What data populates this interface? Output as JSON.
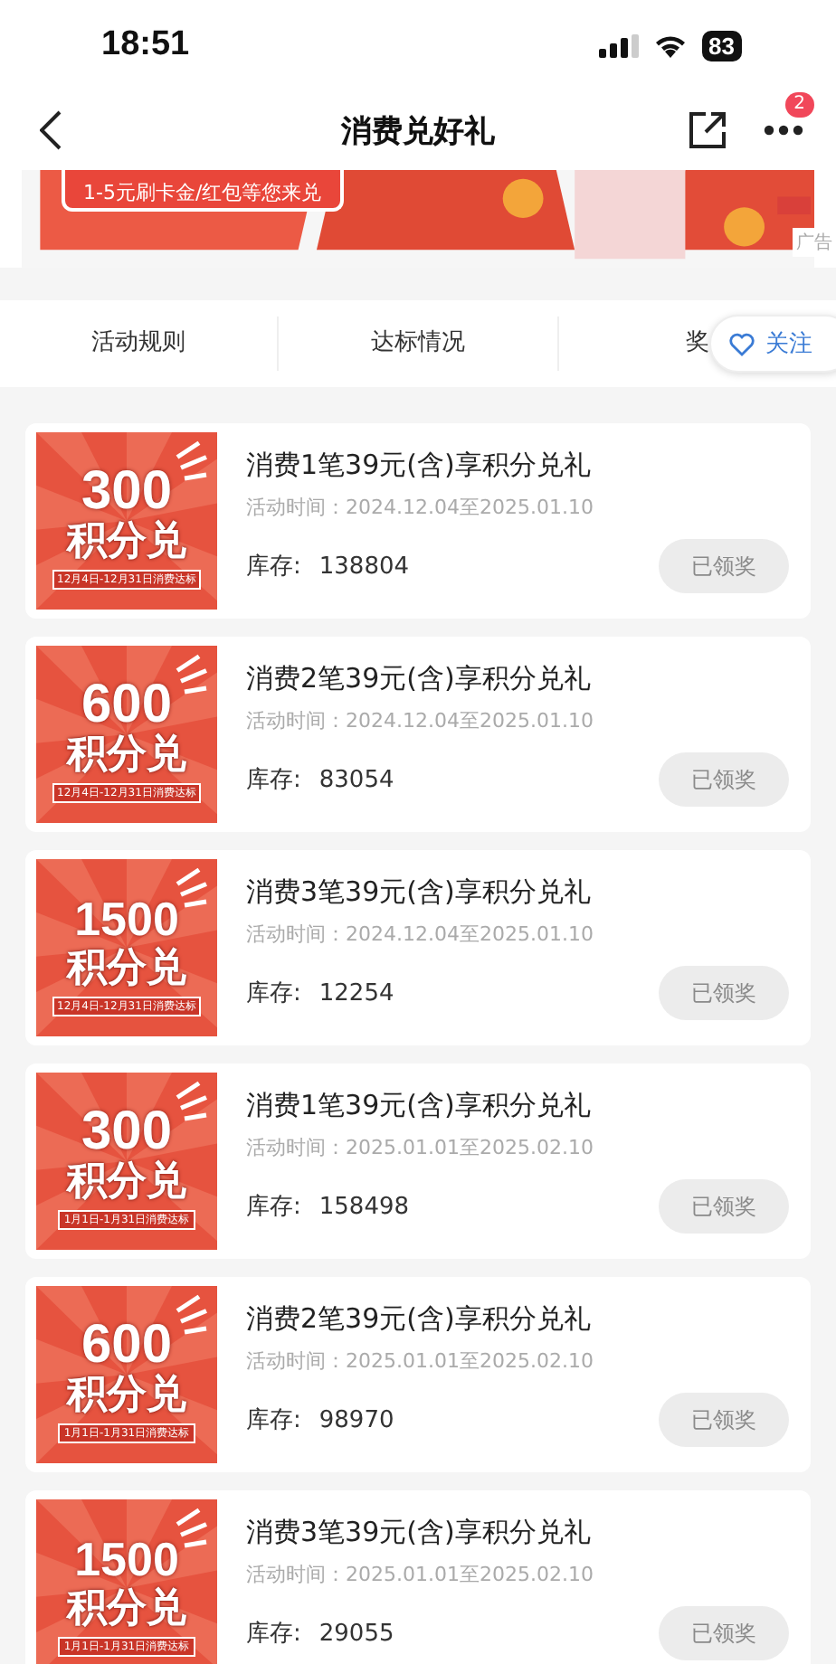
{
  "status_bar": {
    "time": "18:51",
    "battery": "83"
  },
  "nav": {
    "title": "消费兑好礼",
    "badge": "2"
  },
  "banner": {
    "slogan": "1-5元刷卡金/红包等您来兑",
    "ad_label": "广告"
  },
  "tabs": [
    {
      "label": "活动规则"
    },
    {
      "label": "达标情况"
    },
    {
      "label": "奖"
    }
  ],
  "follow_button": {
    "label": "关注"
  },
  "offers": [
    {
      "amount": "300",
      "badge_text": "积分兑",
      "period": "12月4日-12月31日消费达标",
      "title": "消费1笔39元(含)享积分兑礼",
      "time": "活动时间：2024.12.04至2025.01.10",
      "stock_label": "库存:",
      "stock": "138804",
      "button": {
        "label": "已领奖",
        "disabled": true
      }
    },
    {
      "amount": "600",
      "badge_text": "积分兑",
      "period": "12月4日-12月31日消费达标",
      "title": "消费2笔39元(含)享积分兑礼",
      "time": "活动时间：2024.12.04至2025.01.10",
      "stock_label": "库存:",
      "stock": "83054",
      "button": {
        "label": "已领奖",
        "disabled": true
      }
    },
    {
      "amount": "1500",
      "badge_text": "积分兑",
      "period": "12月4日-12月31日消费达标",
      "title": "消费3笔39元(含)享积分兑礼",
      "time": "活动时间：2024.12.04至2025.01.10",
      "stock_label": "库存:",
      "stock": "12254",
      "button": {
        "label": "已领奖",
        "disabled": true
      }
    },
    {
      "amount": "300",
      "badge_text": "积分兑",
      "period": "1月1日-1月31日消费达标",
      "title": "消费1笔39元(含)享积分兑礼",
      "time": "活动时间：2025.01.01至2025.02.10",
      "stock_label": "库存:",
      "stock": "158498",
      "button": {
        "label": "已领奖",
        "disabled": true
      }
    },
    {
      "amount": "600",
      "badge_text": "积分兑",
      "period": "1月1日-1月31日消费达标",
      "title": "消费2笔39元(含)享积分兑礼",
      "time": "活动时间：2025.01.01至2025.02.10",
      "stock_label": "库存:",
      "stock": "98970",
      "button": {
        "label": "已领奖",
        "disabled": true
      }
    },
    {
      "amount": "1500",
      "badge_text": "积分兑",
      "period": "1月1日-1月31日消费达标",
      "title": "消费3笔39元(含)享积分兑礼",
      "time": "活动时间：2025.01.01至2025.02.10",
      "stock_label": "库存:",
      "stock": "29055",
      "button": {
        "label": "已领奖",
        "disabled": true
      }
    }
  ]
}
